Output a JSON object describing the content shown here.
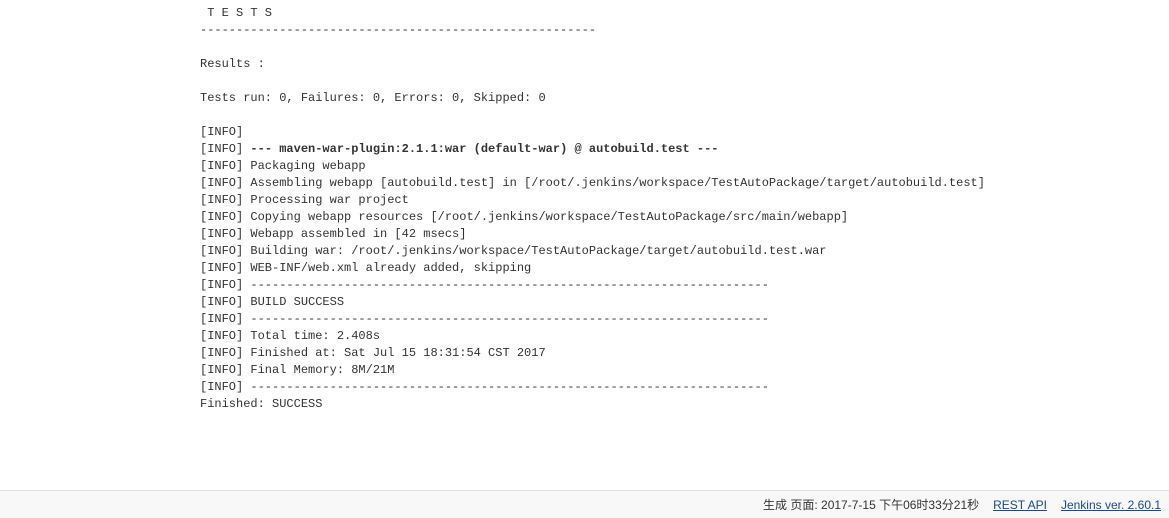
{
  "console": {
    "l0": " T E S T S",
    "l1": "-------------------------------------------------------",
    "l2": "",
    "l3": "Results :",
    "l4": "",
    "l5": "Tests run: 0, Failures: 0, Errors: 0, Skipped: 0",
    "l6": "",
    "l7": "[INFO] ",
    "l8a": "[INFO] ",
    "l8b": "--- maven-war-plugin:2.1.1:war (default-war) @ autobuild.test ---",
    "l9": "[INFO] Packaging webapp",
    "l10": "[INFO] Assembling webapp [autobuild.test] in [/root/.jenkins/workspace/TestAutoPackage/target/autobuild.test]",
    "l11": "[INFO] Processing war project",
    "l12": "[INFO] Copying webapp resources [/root/.jenkins/workspace/TestAutoPackage/src/main/webapp]",
    "l13": "[INFO] Webapp assembled in [42 msecs]",
    "l14": "[INFO] Building war: /root/.jenkins/workspace/TestAutoPackage/target/autobuild.test.war",
    "l15": "[INFO] WEB-INF/web.xml already added, skipping",
    "l16": "[INFO] ------------------------------------------------------------------------",
    "l17": "[INFO] BUILD SUCCESS",
    "l18": "[INFO] ------------------------------------------------------------------------",
    "l19": "[INFO] Total time: 2.408s",
    "l20": "[INFO] Finished at: Sat Jul 15 18:31:54 CST 2017",
    "l21": "[INFO] Final Memory: 8M/21M",
    "l22": "[INFO] ------------------------------------------------------------------------",
    "l23": "Finished: SUCCESS"
  },
  "footer": {
    "generated": "生成 页面: 2017-7-15 下午06时33分21秒",
    "restapi": "REST API",
    "version": "Jenkins ver. 2.60.1"
  }
}
